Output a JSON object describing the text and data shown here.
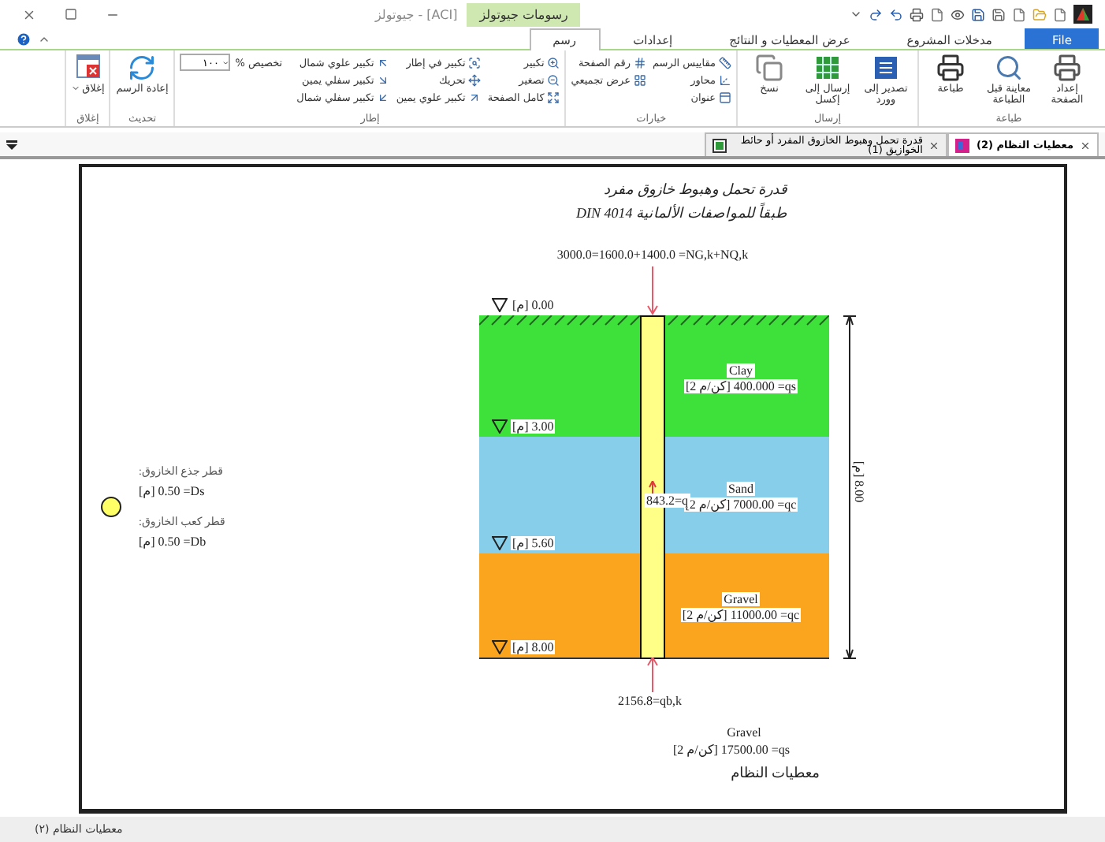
{
  "window": {
    "title": "جيوتولز - [ACI]",
    "context_tab": "رسومات جيوتولز"
  },
  "menu_tabs": [
    {
      "label": "File",
      "kind": "file",
      "selected": false
    },
    {
      "label": "مدخلات المشروع",
      "kind": "tab",
      "selected": false
    },
    {
      "label": "عرض المعطيات و النتائج",
      "kind": "tab",
      "selected": false
    },
    {
      "label": "إعدادات",
      "kind": "tab",
      "selected": false
    },
    {
      "label": "رسم",
      "kind": "tab",
      "selected": true
    }
  ],
  "ribbon": [
    {
      "title": "طباعة",
      "items": [
        {
          "kind": "large",
          "label": "إعداد الصفحة"
        },
        {
          "kind": "large",
          "label": "معاينة قبل الطباعة"
        },
        {
          "kind": "large",
          "label": "طباعة"
        }
      ]
    },
    {
      "title": "إرسال",
      "items": [
        {
          "kind": "large",
          "label": "تصدير إلى وورد"
        },
        {
          "kind": "large",
          "label": "إرسال إلى إكسل"
        },
        {
          "kind": "large",
          "label": "نسخ"
        }
      ]
    },
    {
      "title": "خيارات",
      "items": [
        {
          "kind": "small",
          "label": "مقاييس الرسم"
        },
        {
          "kind": "small",
          "label": "محاور"
        },
        {
          "kind": "small",
          "label": "عنوان"
        },
        {
          "kind": "small",
          "label": "رقم الصفحة"
        },
        {
          "kind": "small",
          "label": "عرض تجميعي"
        }
      ]
    },
    {
      "title": "إطار",
      "items": [
        {
          "kind": "small",
          "label": "تكبير"
        },
        {
          "kind": "small",
          "label": "تصغير"
        },
        {
          "kind": "small",
          "label": "كامل الصفحة"
        },
        {
          "kind": "small",
          "label": "تكبير في إطار"
        },
        {
          "kind": "small",
          "label": "تحريك"
        },
        {
          "kind": "small",
          "label": "تكبير علوي يمين"
        },
        {
          "kind": "small",
          "label": "تكبير علوي شمال"
        },
        {
          "kind": "small",
          "label": "تكبير سفلي يمين"
        },
        {
          "kind": "small",
          "label": "تكبير سفلي شمال"
        },
        {
          "kind": "field",
          "label": "تخصيص %",
          "value": "١٠٠"
        }
      ]
    },
    {
      "title": "تحديث",
      "items": [
        {
          "kind": "large",
          "label": "إعادة الرسم"
        }
      ]
    },
    {
      "title": "إغلاق",
      "items": [
        {
          "kind": "dropdown",
          "label": "إغلاق"
        }
      ]
    }
  ],
  "doc_tabs": [
    {
      "label": "معطيات النظام (2)",
      "selected": true
    },
    {
      "label": "قدرة تحمل وهبوط الخازوق المفرد أو حائط الخوازيق (1)",
      "selected": false
    }
  ],
  "drawing": {
    "title": "قدرة تحمل وهبوط خازوق مفرد",
    "subtitle": "طبقاً للمواصفات الألمانية  DIN 4014",
    "load": "3000.0=1600.0+1400.0 =NG,k+NQ,k",
    "top_level": "[م] 0.00",
    "layers": [
      {
        "name": "Clay",
        "value": "[كن/م 2] 400.000 =qs",
        "bottom_level": "[م] 3.00",
        "color": "#3ee03a"
      },
      {
        "name": "Sand",
        "value": "[كن/م 2] 7000.00 =qc",
        "bottom_level": "[م] 5.60",
        "color": "#87ceeb"
      },
      {
        "name": "Gravel",
        "value": "[كن/م 2] 11000.00 =qc",
        "bottom_level": "[م] 8.00",
        "color": "#fba51e"
      }
    ],
    "shaft_resistance": "843.2=q",
    "depth": "[م] 8.00",
    "base_resistance": "2156.8=qb,k",
    "base_layer": {
      "name": "Gravel",
      "value": "[كن/م 2] 17500.00 =qs"
    },
    "footer": "معطيات النظام",
    "pile": [
      {
        "label": "قطر جذع الخازوق:",
        "value": "[م] 0.50 =Ds"
      },
      {
        "label": "قطر كعب الخازوق:",
        "value": "[م] 0.50 =Db"
      }
    ]
  },
  "status_bar": {
    "text": "معطيات النظام (٢)"
  }
}
